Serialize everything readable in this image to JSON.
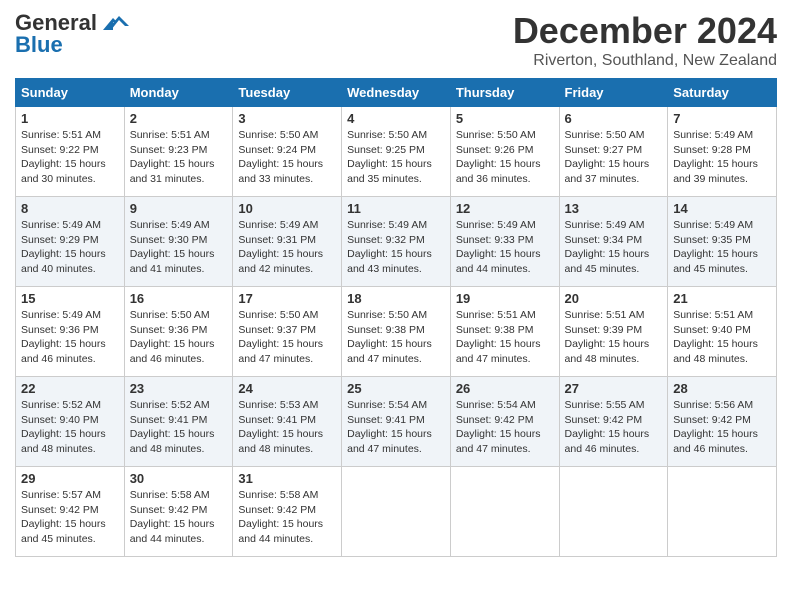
{
  "logo": {
    "line1": "General",
    "line2": "Blue"
  },
  "title": "December 2024",
  "location": "Riverton, Southland, New Zealand",
  "headers": [
    "Sunday",
    "Monday",
    "Tuesday",
    "Wednesday",
    "Thursday",
    "Friday",
    "Saturday"
  ],
  "weeks": [
    [
      {
        "day": "1",
        "sunrise": "5:51 AM",
        "sunset": "9:22 PM",
        "daylight": "15 hours and 30 minutes."
      },
      {
        "day": "2",
        "sunrise": "5:51 AM",
        "sunset": "9:23 PM",
        "daylight": "15 hours and 31 minutes."
      },
      {
        "day": "3",
        "sunrise": "5:50 AM",
        "sunset": "9:24 PM",
        "daylight": "15 hours and 33 minutes."
      },
      {
        "day": "4",
        "sunrise": "5:50 AM",
        "sunset": "9:25 PM",
        "daylight": "15 hours and 35 minutes."
      },
      {
        "day": "5",
        "sunrise": "5:50 AM",
        "sunset": "9:26 PM",
        "daylight": "15 hours and 36 minutes."
      },
      {
        "day": "6",
        "sunrise": "5:50 AM",
        "sunset": "9:27 PM",
        "daylight": "15 hours and 37 minutes."
      },
      {
        "day": "7",
        "sunrise": "5:49 AM",
        "sunset": "9:28 PM",
        "daylight": "15 hours and 39 minutes."
      }
    ],
    [
      {
        "day": "8",
        "sunrise": "5:49 AM",
        "sunset": "9:29 PM",
        "daylight": "15 hours and 40 minutes."
      },
      {
        "day": "9",
        "sunrise": "5:49 AM",
        "sunset": "9:30 PM",
        "daylight": "15 hours and 41 minutes."
      },
      {
        "day": "10",
        "sunrise": "5:49 AM",
        "sunset": "9:31 PM",
        "daylight": "15 hours and 42 minutes."
      },
      {
        "day": "11",
        "sunrise": "5:49 AM",
        "sunset": "9:32 PM",
        "daylight": "15 hours and 43 minutes."
      },
      {
        "day": "12",
        "sunrise": "5:49 AM",
        "sunset": "9:33 PM",
        "daylight": "15 hours and 44 minutes."
      },
      {
        "day": "13",
        "sunrise": "5:49 AM",
        "sunset": "9:34 PM",
        "daylight": "15 hours and 45 minutes."
      },
      {
        "day": "14",
        "sunrise": "5:49 AM",
        "sunset": "9:35 PM",
        "daylight": "15 hours and 45 minutes."
      }
    ],
    [
      {
        "day": "15",
        "sunrise": "5:49 AM",
        "sunset": "9:36 PM",
        "daylight": "15 hours and 46 minutes."
      },
      {
        "day": "16",
        "sunrise": "5:50 AM",
        "sunset": "9:36 PM",
        "daylight": "15 hours and 46 minutes."
      },
      {
        "day": "17",
        "sunrise": "5:50 AM",
        "sunset": "9:37 PM",
        "daylight": "15 hours and 47 minutes."
      },
      {
        "day": "18",
        "sunrise": "5:50 AM",
        "sunset": "9:38 PM",
        "daylight": "15 hours and 47 minutes."
      },
      {
        "day": "19",
        "sunrise": "5:51 AM",
        "sunset": "9:38 PM",
        "daylight": "15 hours and 47 minutes."
      },
      {
        "day": "20",
        "sunrise": "5:51 AM",
        "sunset": "9:39 PM",
        "daylight": "15 hours and 48 minutes."
      },
      {
        "day": "21",
        "sunrise": "5:51 AM",
        "sunset": "9:40 PM",
        "daylight": "15 hours and 48 minutes."
      }
    ],
    [
      {
        "day": "22",
        "sunrise": "5:52 AM",
        "sunset": "9:40 PM",
        "daylight": "15 hours and 48 minutes."
      },
      {
        "day": "23",
        "sunrise": "5:52 AM",
        "sunset": "9:41 PM",
        "daylight": "15 hours and 48 minutes."
      },
      {
        "day": "24",
        "sunrise": "5:53 AM",
        "sunset": "9:41 PM",
        "daylight": "15 hours and 48 minutes."
      },
      {
        "day": "25",
        "sunrise": "5:54 AM",
        "sunset": "9:41 PM",
        "daylight": "15 hours and 47 minutes."
      },
      {
        "day": "26",
        "sunrise": "5:54 AM",
        "sunset": "9:42 PM",
        "daylight": "15 hours and 47 minutes."
      },
      {
        "day": "27",
        "sunrise": "5:55 AM",
        "sunset": "9:42 PM",
        "daylight": "15 hours and 46 minutes."
      },
      {
        "day": "28",
        "sunrise": "5:56 AM",
        "sunset": "9:42 PM",
        "daylight": "15 hours and 46 minutes."
      }
    ],
    [
      {
        "day": "29",
        "sunrise": "5:57 AM",
        "sunset": "9:42 PM",
        "daylight": "15 hours and 45 minutes."
      },
      {
        "day": "30",
        "sunrise": "5:58 AM",
        "sunset": "9:42 PM",
        "daylight": "15 hours and 44 minutes."
      },
      {
        "day": "31",
        "sunrise": "5:58 AM",
        "sunset": "9:42 PM",
        "daylight": "15 hours and 44 minutes."
      },
      null,
      null,
      null,
      null
    ]
  ]
}
